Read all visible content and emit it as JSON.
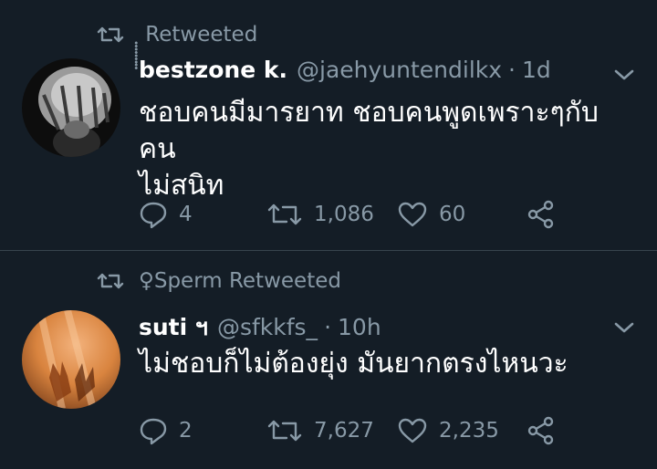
{
  "tweets": [
    {
      "retweeted_by": "ฺฺฺฺฺฺฺฺฺ Retweeted",
      "name": "bestzone k.",
      "handle": "@jaehyuntendilkx",
      "time": "1d",
      "text": "ชอบคนมีมารยาท ชอบคนพูดเพราะๆกับคน\nไม่สนิท",
      "replies": "4",
      "retweets": "1,086",
      "likes": "60"
    },
    {
      "retweeted_by": "♀Sperm Retweeted",
      "name": "suti ฯ",
      "handle": "@sfkkfs_",
      "time": "10h",
      "text": "ไม่ชอบก็ไม่ต้องยุ่ง มันยากตรงไหนวะ",
      "replies": "2",
      "retweets": "7,627",
      "likes": "2,235"
    }
  ],
  "icons": {
    "retweet": "retweet-icon",
    "reply": "reply-icon",
    "like": "heart-icon",
    "share": "share-icon",
    "more": "chevron-down-icon"
  },
  "colors": {
    "background": "#141d26",
    "secondary_text": "#8899a6",
    "divider": "#38444d"
  }
}
